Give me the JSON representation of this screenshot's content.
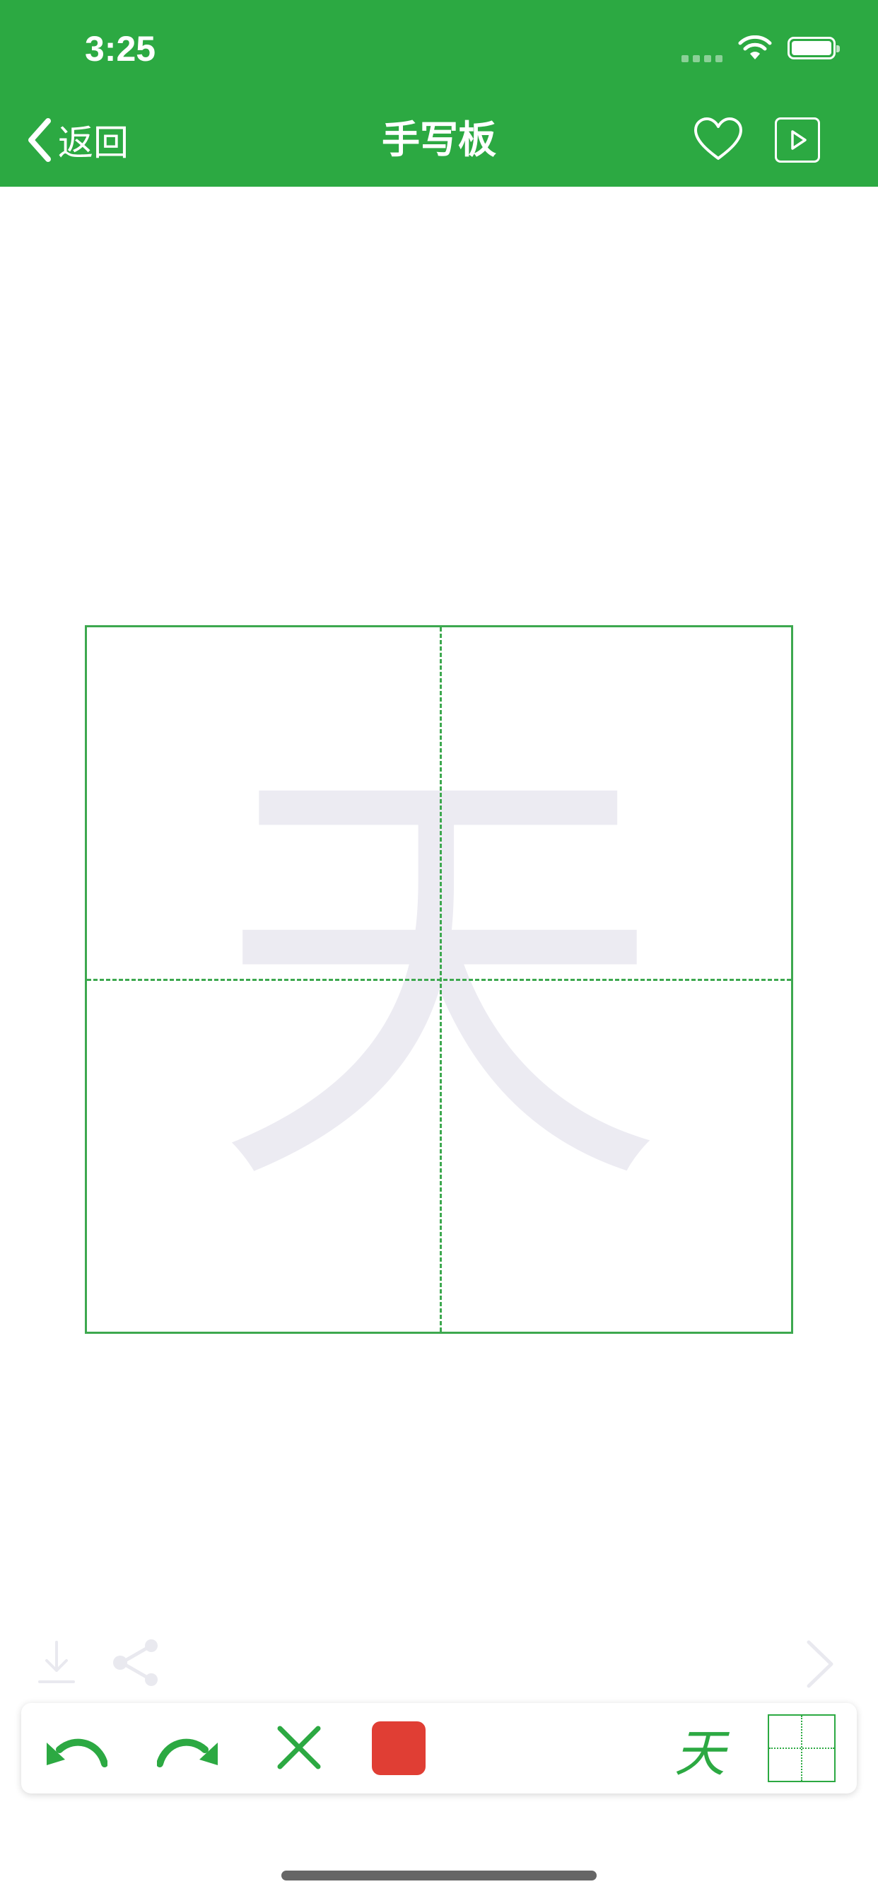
{
  "status_bar": {
    "time": "3:25"
  },
  "header": {
    "back_label": "返回",
    "title": "手写板",
    "favorite_icon": "heart-outline-icon",
    "play_icon": "play-square-icon"
  },
  "canvas": {
    "guide_character": "天"
  },
  "actions": {
    "download_icon": "download-icon",
    "share_icon": "share-icon",
    "next_icon": "chevron-right-icon"
  },
  "toolbar": {
    "undo_icon": "undo-icon",
    "redo_icon": "redo-icon",
    "clear_icon": "close-icon",
    "pen_color": "#e03e34",
    "char_toggle_label": "天",
    "grid_toggle_icon": "grid-icon"
  },
  "colors": {
    "brand_green": "#2ca942",
    "grid_line": "#3da84f",
    "guide_char": "#ecebf2",
    "faded_icon": "#e9e9ef"
  }
}
